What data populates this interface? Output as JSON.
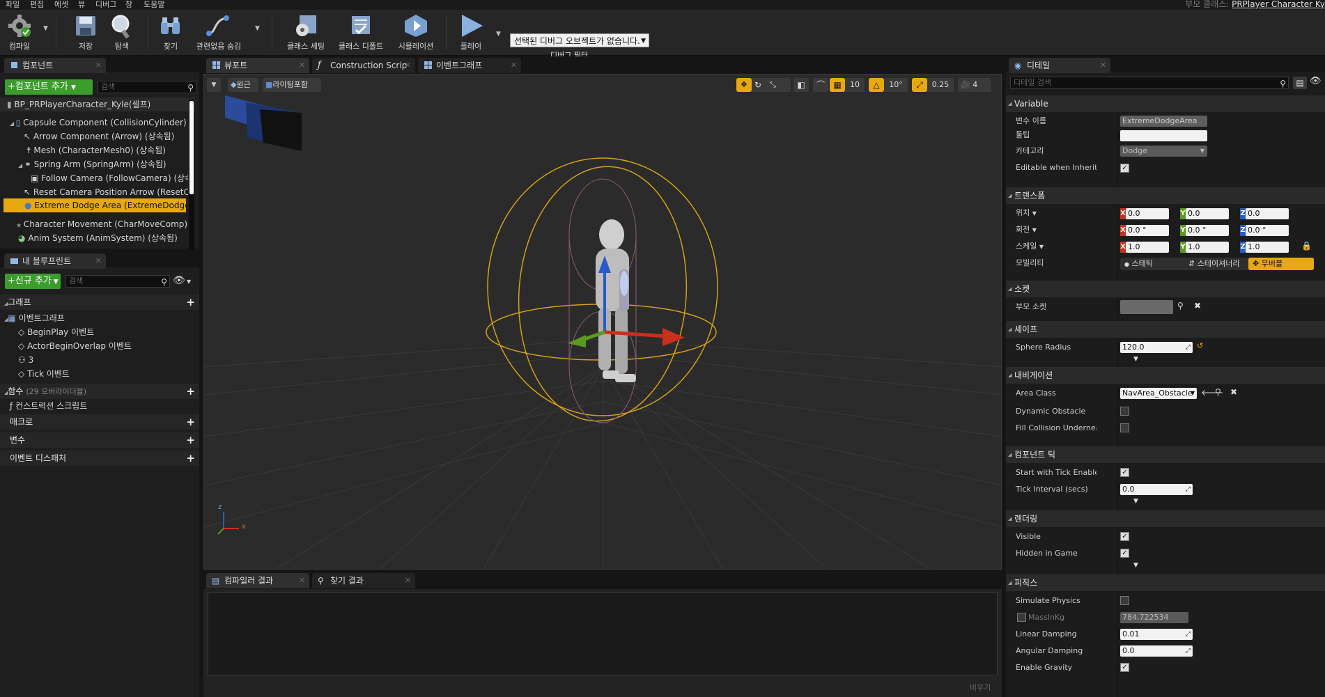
{
  "menu": [
    "파일",
    "편집",
    "에셋",
    "뷰",
    "디버그",
    "창",
    "도움말"
  ],
  "parent_class": {
    "label": "부모 클래스:",
    "value": "PRPlayer Character Ky"
  },
  "toolbar": {
    "compile": "컴파일",
    "save": "저장",
    "browse": "탐색",
    "find": "찾기",
    "hide_unrelated": "관련없음 숨김",
    "class_settings": "클래스 세팅",
    "class_defaults": "클래스 디폴트",
    "simulation": "시뮬레이션",
    "play": "플레이",
    "debug_select": "선택된 디버그 오브젝트가 없습니다.",
    "debug_filter": "디버그 필터"
  },
  "components_panel": {
    "tab": "컴포넌트",
    "add_button": "+컴포넌트 추가",
    "search_placeholder": "검색",
    "items": [
      {
        "label": "BP_PRPlayerCharacter_Kyle(셀프)"
      },
      {
        "label": "Capsule Component (CollisionCylinder) (상"
      },
      {
        "label": "Arrow Component (Arrow) (상속됨)"
      },
      {
        "label": "Mesh (CharacterMesh0) (상속됨)"
      },
      {
        "label": "Spring Arm (SpringArm) (상속됨)"
      },
      {
        "label": "Follow Camera (FollowCamera) (상속됨"
      },
      {
        "label": "Reset Camera Position Arrow (ResetCar"
      },
      {
        "label": "Extreme Dodge Area (ExtremeDodgeArea"
      },
      {
        "label": "Character Movement (CharMoveComp) (상"
      },
      {
        "label": "Anim System (AnimSystem) (상속됨)"
      }
    ]
  },
  "blueprint_panel": {
    "tab": "내 블루프린트",
    "add_button": "+신규 추가",
    "search_placeholder": "검색",
    "graph_section": "그래프",
    "event_graph": "이벤트그래프",
    "events": [
      "BeginPlay 이벤트",
      "ActorBeginOverlap 이벤트",
      "3",
      "Tick 이벤트"
    ],
    "functions_section": "함수",
    "functions_count": "(29 오버라이더블)",
    "construction_script": "컨스트럭션 스크립트",
    "macros": "매크로",
    "variables": "변수",
    "dispatchers": "이벤트 디스패처"
  },
  "center_tabs": [
    "뷰포트",
    "Construction Scrip",
    "이벤트그래프"
  ],
  "viewport": {
    "perspective": "원근",
    "lit": "라이팅포함",
    "grid_snap": "10",
    "rot_snap": "10°",
    "scale_snap": "0.25",
    "cam_speed": "4",
    "axis_x": "x",
    "axis_z": "z"
  },
  "bottom_tabs": [
    "컴파일러 결과",
    "찾기 결과"
  ],
  "bottom_clear": "비우기",
  "details": {
    "tab": "디테일",
    "search_placeholder": "디테일 검색",
    "variable_section": "Variable",
    "var_name_label": "변수 이름",
    "var_name": "ExtremeDodgeArea",
    "tooltip_label": "툴팁",
    "tooltip": "",
    "category_label": "카테고리",
    "category": "Dodge",
    "editable_label": "Editable when Inherited",
    "transform_section": "트랜스폼",
    "location_label": "위치",
    "location": [
      "0.0",
      "0.0",
      "0.0"
    ],
    "rotation_label": "회전",
    "rotation": [
      "0.0 °",
      "0.0 °",
      "0.0 °"
    ],
    "scale_label": "스케일",
    "scale": [
      "1.0",
      "1.0",
      "1.0"
    ],
    "mobility_label": "모빌리티",
    "mobility": [
      "스태틱",
      "스테이셔너리",
      "무버블"
    ],
    "socket_section": "소켓",
    "parent_socket_label": "부모 소켓",
    "parent_socket": "",
    "shape_section": "셰이프",
    "sphere_radius_label": "Sphere Radius",
    "sphere_radius": "120.0",
    "nav_section": "내비게이션",
    "area_class_label": "Area Class",
    "area_class": "NavArea_Obstacle",
    "dynamic_obstacle_label": "Dynamic Obstacle",
    "fill_collision_label": "Fill Collision Underneath for N",
    "tick_section": "컴포넌트 틱",
    "start_tick_label": "Start with Tick Enabled",
    "tick_interval_label": "Tick Interval (secs)",
    "tick_interval": "0.0",
    "render_section": "렌더링",
    "visible_label": "Visible",
    "hidden_label": "Hidden in Game",
    "physics_section": "피직스",
    "simulate_label": "Simulate Physics",
    "mass_label": "MassInKg",
    "mass": "784.722534",
    "linear_damping_label": "Linear Damping",
    "linear_damping": "0.01",
    "angular_damping_label": "Angular Damping",
    "angular_damping": "0.0",
    "gravity_label": "Enable Gravity"
  },
  "colors": {
    "accent": "#e8a810",
    "green": "#3c9c2c",
    "axis_x": "#c8301c",
    "axis_y": "#5a9a1c",
    "axis_z": "#2a5ac8"
  }
}
